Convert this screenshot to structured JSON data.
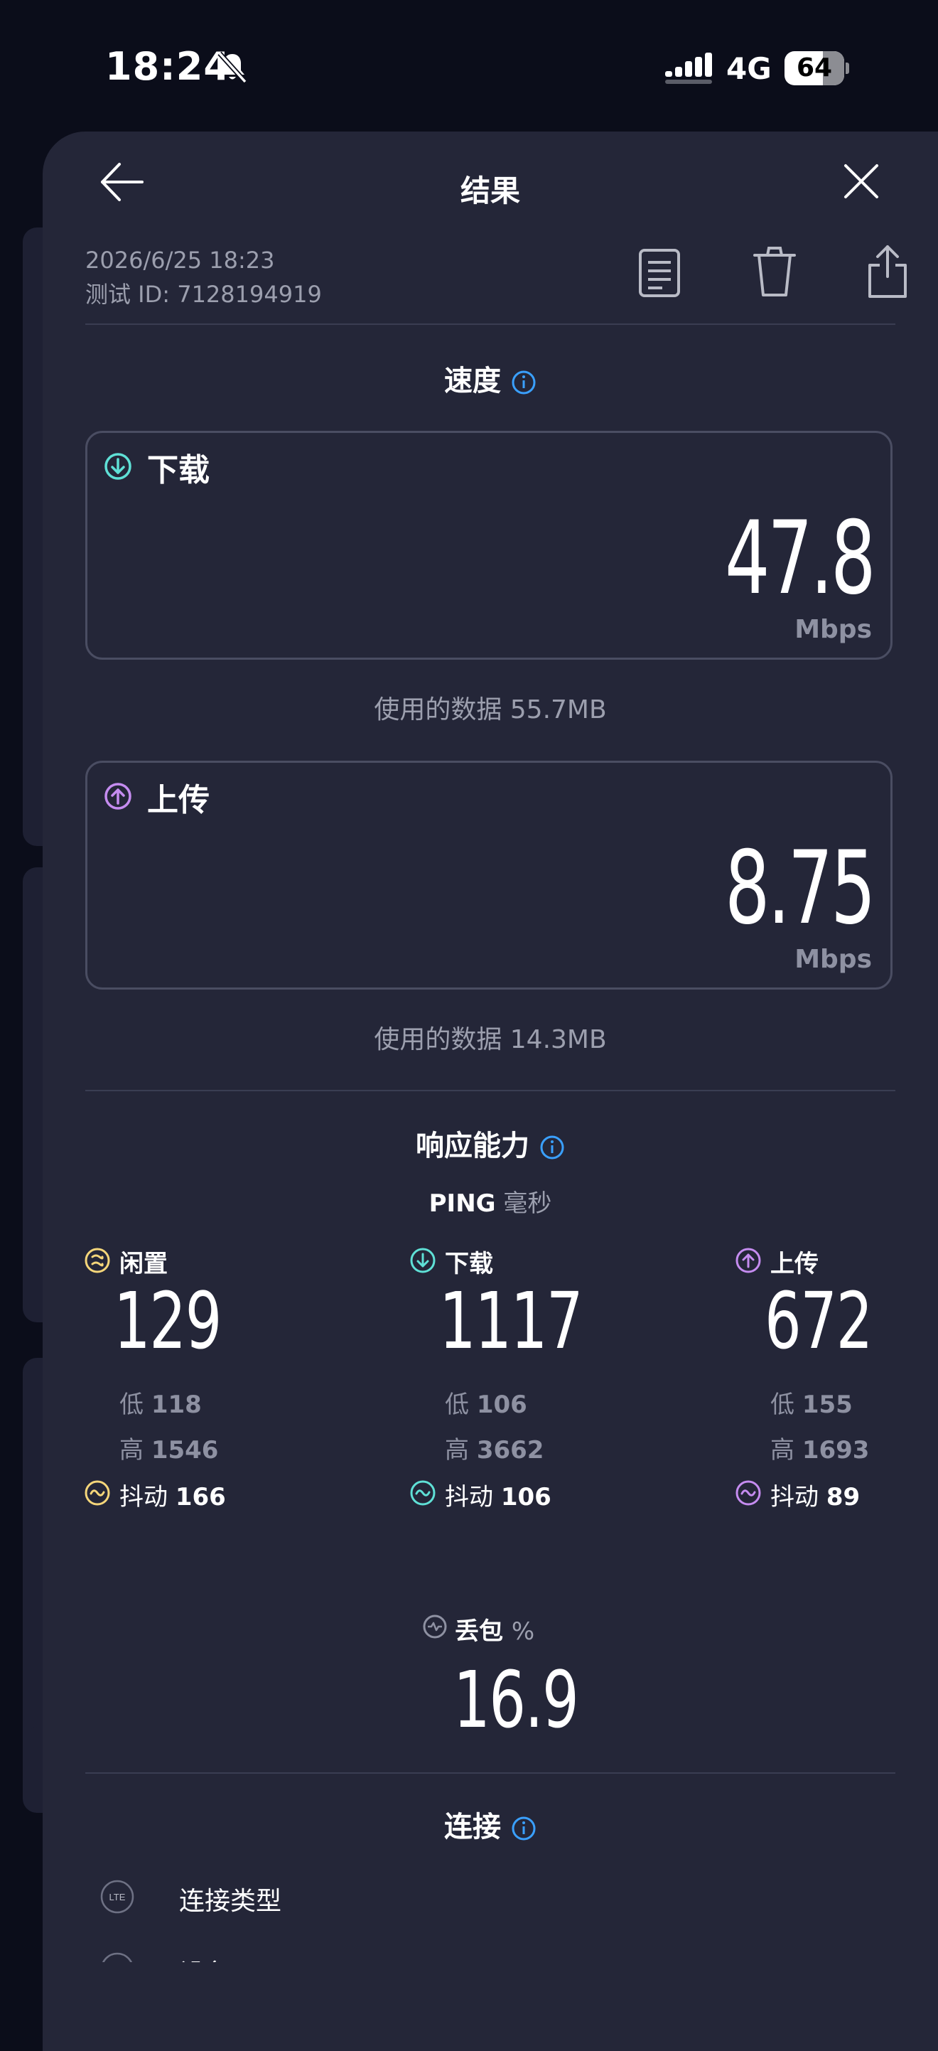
{
  "status_bar": {
    "time": "18:24",
    "network": "4G",
    "battery": "64"
  },
  "header": {
    "title": "结果"
  },
  "meta": {
    "datetime": "2026/6/25 18:23",
    "test_id": "测试 ID: 7128194919"
  },
  "speed": {
    "title": "速度",
    "download": {
      "label": "下载",
      "value": "47.8",
      "unit": "Mbps",
      "data_used": "使用的数据 55.7MB"
    },
    "upload": {
      "label": "上传",
      "value": "8.75",
      "unit": "Mbps",
      "data_used": "使用的数据 14.3MB"
    }
  },
  "responsiveness": {
    "title": "响应能力",
    "ping_label": "PING",
    "ping_unit": "毫秒",
    "columns": [
      {
        "label": "闲置",
        "value": "129",
        "low_label": "低",
        "low": "118",
        "high_label": "高",
        "high": "1546",
        "jitter_label": "抖动",
        "jitter": "166",
        "color": "#f5d67a"
      },
      {
        "label": "下载",
        "value": "1117",
        "low_label": "低",
        "low": "106",
        "high_label": "高",
        "high": "3662",
        "jitter_label": "抖动",
        "jitter": "106",
        "color": "#5fe0d6"
      },
      {
        "label": "上传",
        "value": "672",
        "low_label": "低",
        "low": "155",
        "high_label": "高",
        "high": "1693",
        "jitter_label": "抖动",
        "jitter": "89",
        "color": "#c58cf0"
      }
    ],
    "packet_loss": {
      "label": "丢包",
      "unit": "%",
      "value": "16.9"
    }
  },
  "connection": {
    "title": "连接",
    "rows": [
      {
        "icon": "LTE",
        "label": "连接类型"
      },
      {
        "icon": "",
        "label": "设备"
      }
    ]
  },
  "colors": {
    "accent_info": "#3aa0ff",
    "download": "#5fe0d6",
    "upload": "#c58cf0",
    "idle": "#f5d67a"
  }
}
